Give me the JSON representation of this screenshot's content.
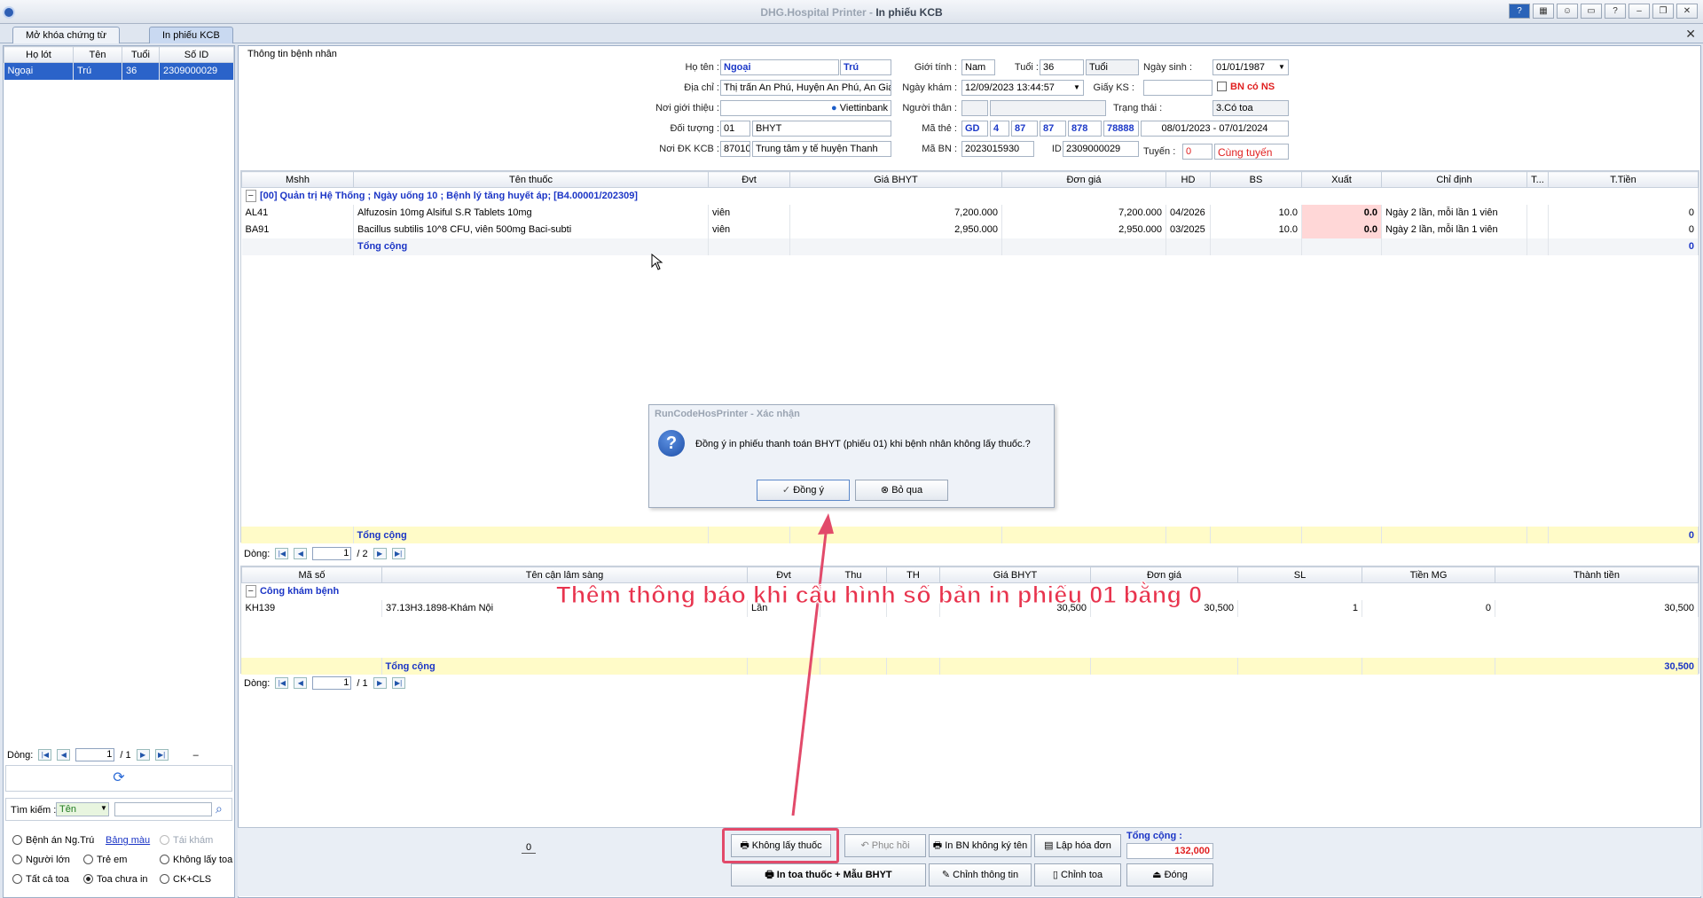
{
  "window": {
    "title_app": "DHG.Hospital Printer",
    "title_sep": " - ",
    "title_screen": "In phiếu KCB"
  },
  "tabs": [
    "Mở khóa chứng từ",
    "In phiếu KCB"
  ],
  "left": {
    "headers": [
      "Họ lót",
      "Tên",
      "Tuổi",
      "Số ID"
    ],
    "row": [
      "Ngoại",
      "Trú",
      "36",
      "2309000029"
    ],
    "nav_label": "Dòng:",
    "nav_page": "1",
    "nav_total": "/ 1",
    "nav_dash": "–",
    "search_label": "Tìm kiếm :",
    "search_mode": "Tên",
    "filters": {
      "benh_an": "Bệnh án Ng.Trú",
      "bang_mau": "Bảng màu",
      "tai_kham": "Tái khám",
      "nguoi_lon": "Người lớn",
      "tre_em": "Trẻ em",
      "khong_lay_toa": "Không lấy toa",
      "tat_ca_toa": "Tất cả toa",
      "toa_chua_in": "Toa chưa in",
      "ck_cls": "CK+CLS"
    }
  },
  "patient": {
    "section": "Thông tin bệnh nhân",
    "ho_ten_label": "Họ tên :",
    "ho": "Ngoại",
    "ten": "Trú",
    "gioi_tinh_label": "Giới tính :",
    "gioi_tinh": "Nam",
    "tuoi_label": "Tuổi :",
    "tuoi": "36",
    "tuoi_unit": "Tuổi",
    "ngay_sinh_label": "Ngày sinh :",
    "ngay_sinh": "01/01/1987",
    "dia_chi_label": "Địa chỉ :",
    "dia_chi": "Thị trấn An Phú, Huyện An Phú, An Giang",
    "ngay_kham_label": "Ngày khám :",
    "ngay_kham": "12/09/2023 13:44:57",
    "giay_ks_label": "Giấy KS :",
    "bn_co_ns": "BN có NS",
    "noi_gioi_thieu_label": "Nơi giới thiệu :",
    "bank": "Viettinbank",
    "nguoi_than_label": "Người thân :",
    "trang_thai_label": "Trạng thái :",
    "trang_thai": "3.Có toa",
    "doi_tuong_label": "Đối tượng :",
    "doi_tuong_code": "01",
    "doi_tuong": "BHYT",
    "ma_the_label": "Mã thẻ :",
    "ma_the": [
      "GD",
      "4",
      "87",
      "87",
      "878",
      "78888"
    ],
    "han_the": "08/01/2023 - 07/01/2024",
    "noi_dk_label": "Nơi ĐK KCB :",
    "noi_dk_code": "87010",
    "noi_dk": "Trung tâm y tế huyện Thanh",
    "ma_bn_label": "Mã BN :",
    "ma_bn": "2023015930",
    "id_label": "ID :",
    "id": "2309000029",
    "tuyen_label": "Tuyến :",
    "tuyen_code": "0",
    "tuyen": "Cùng tuyến"
  },
  "drugs": {
    "headers": [
      "Mshh",
      "Tên thuốc",
      "Đvt",
      "Giá BHYT",
      "Đơn giá",
      "HD",
      "BS",
      "Xuất",
      "Chỉ định",
      "T...",
      "T.Tiền"
    ],
    "group": "[00] Quản trị Hệ Thống ; Ngày uống 10 ; Bệnh lý tăng huyết áp; [B4.00001/202309]",
    "rows": [
      [
        "AL41",
        "Alfuzosin 10mg Alsiful S.R Tablets 10mg",
        "viên",
        "7,200.000",
        "7,200.000",
        "04/2026",
        "10.0",
        "0.0",
        "Ngày 2 lần, mỗi lần 1 viên",
        "",
        "0"
      ],
      [
        "BA91",
        "Bacillus subtilis 10^8 CFU, viên 500mg Baci-subti",
        "viên",
        "2,950.000",
        "2,950.000",
        "03/2025",
        "10.0",
        "0.0",
        "Ngày 2 lần, mỗi lần 1 viên",
        "",
        "0"
      ]
    ],
    "subtotal_label": "Tổng cộng",
    "subtotal": "0",
    "total_label": "Tổng cộng",
    "total": "0",
    "nav_label": "Dòng:",
    "nav_page": "1",
    "nav_total": "/ 2"
  },
  "cls": {
    "headers": [
      "Mã số",
      "Tên cận lâm sàng",
      "Đvt",
      "Thu",
      "TH",
      "Giá BHYT",
      "Đơn giá",
      "SL",
      "Tiền MG",
      "Thành tiền"
    ],
    "group": "Công khám bệnh",
    "row": [
      "KH139",
      "37.13H3.1898-Khám Nội",
      "Lần",
      "",
      "",
      "30,500",
      "30,500",
      "1",
      "0",
      "30,500"
    ],
    "total_label": "Tổng cộng",
    "total": "30,500",
    "nav_label": "Dòng:",
    "nav_page": "1",
    "nav_total": "/ 1"
  },
  "dialog": {
    "title": "RunCodeHosPrinter - Xác nhận",
    "message": "Đồng ý in phiếu thanh toán BHYT (phiếu 01) khi bệnh nhân không lấy thuốc.?",
    "ok": "Đồng ý",
    "cancel": "Bỏ qua"
  },
  "annotation": "Thêm thông báo khi cấu hình số bản in phiếu 01 bằng 0",
  "bottom": {
    "zero": "0",
    "khong_lay_thuoc": "Không lấy thuốc",
    "phuc_hoi": "Phục hồi",
    "in_bn_khong_ky": "In BN không ký tên",
    "lap_hoa_don": "Lập hóa đơn",
    "tong_cong_label": "Tổng cộng :",
    "tong_cong": "132,000",
    "in_toa": "In toa thuốc + Mẫu BHYT",
    "chinh_thong_tin": "Chỉnh thông tin",
    "chinh_toa": "Chỉnh toa",
    "dong": "Đóng"
  },
  "colors": {
    "accent": "#1b35c6",
    "red": "#e02020",
    "highlight": "#e8344e",
    "selected": "#2b63c9"
  }
}
